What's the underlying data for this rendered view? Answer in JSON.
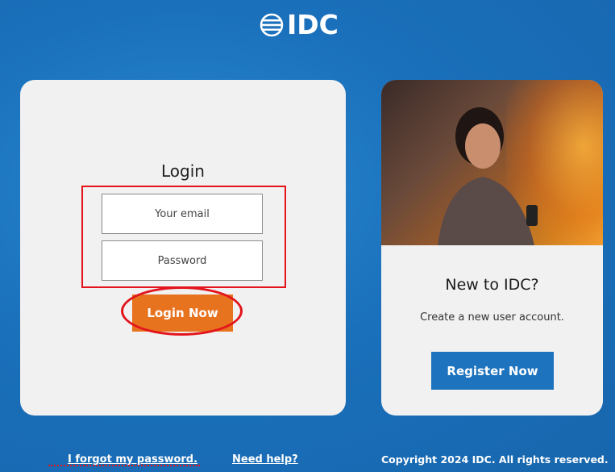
{
  "brand": {
    "logo_text": "IDC",
    "logo_icon": "idc-globe-icon"
  },
  "login": {
    "title": "Login",
    "email_placeholder": "Your email",
    "password_placeholder": "Password",
    "submit_label": "Login Now"
  },
  "register": {
    "image": "woman-with-phone-photo",
    "title": "New to IDC?",
    "subtitle": "Create a new user account.",
    "button_label": "Register Now"
  },
  "footer": {
    "forgot_password": "I forgot my password.",
    "need_help": "Need help?",
    "copyright": "Copyright 2024 IDC. All rights reserved."
  },
  "colors": {
    "background": "#1a70bb",
    "login_button": "#e8731f",
    "register_button": "#1e73be",
    "card": "#f1f1f1",
    "highlight": "#e3141b"
  }
}
